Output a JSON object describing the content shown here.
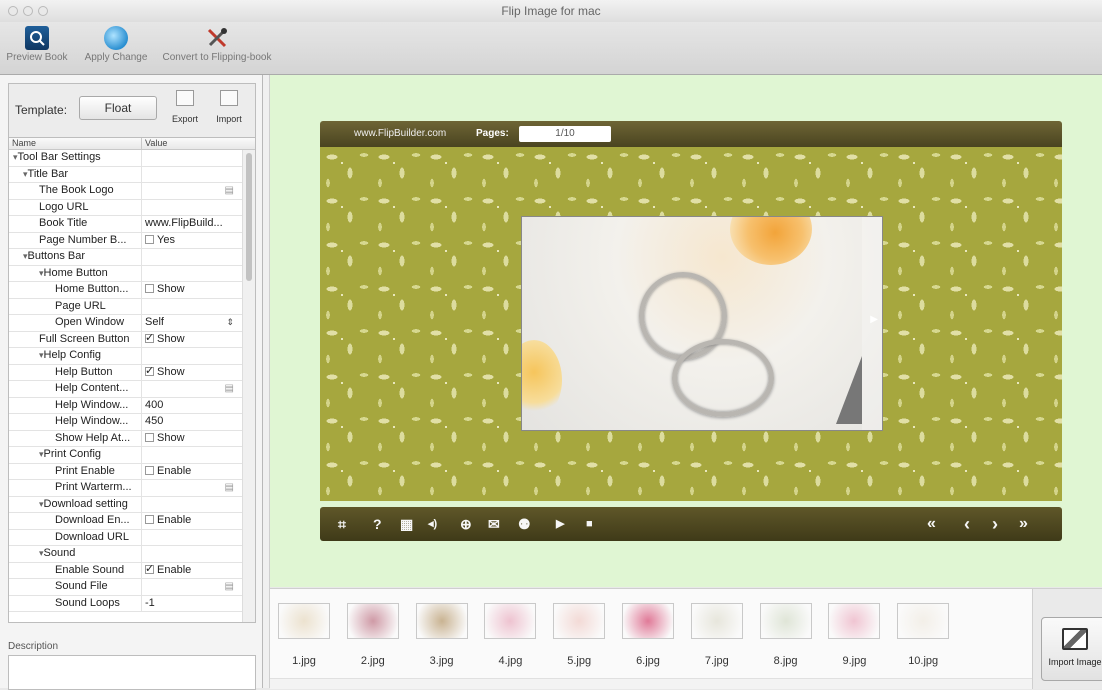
{
  "window": {
    "title": "Flip Image for mac"
  },
  "toolbar": {
    "preview_label": "Preview Book",
    "apply_label": "Apply Change",
    "convert_label": "Convert to Flipping-book"
  },
  "template": {
    "label": "Template:",
    "value": "Float",
    "export_label": "Export",
    "import_label": "Import"
  },
  "grid": {
    "col_name": "Name",
    "col_value": "Value",
    "rows": [
      {
        "name": "Tool Bar Settings",
        "type": "header"
      },
      {
        "name": "Title Bar",
        "type": "header"
      },
      {
        "name": "The Book Logo",
        "type": "file"
      },
      {
        "name": "Logo URL",
        "value": ""
      },
      {
        "name": "Book Title",
        "value": "www.FlipBuild..."
      },
      {
        "name": "Page Number B...",
        "type": "check",
        "value": "Yes",
        "checked": false
      },
      {
        "name": "Buttons Bar",
        "type": "header"
      },
      {
        "name": "Home Button",
        "type": "header"
      },
      {
        "name": "Home Button...",
        "type": "check",
        "value": "Show",
        "checked": false
      },
      {
        "name": "Page URL",
        "value": ""
      },
      {
        "name": "Open Window",
        "type": "select",
        "value": "Self"
      },
      {
        "name": "Full Screen Button",
        "type": "check",
        "value": "Show",
        "checked": true
      },
      {
        "name": "Help Config",
        "type": "header"
      },
      {
        "name": "Help Button",
        "type": "check",
        "value": "Show",
        "checked": true
      },
      {
        "name": "Help Content...",
        "type": "file"
      },
      {
        "name": "Help Window...",
        "value": "400"
      },
      {
        "name": "Help Window...",
        "value": "450"
      },
      {
        "name": "Show Help At...",
        "type": "check",
        "value": "Show",
        "checked": false
      },
      {
        "name": "Print Config",
        "type": "header"
      },
      {
        "name": "Print Enable",
        "type": "check",
        "value": "Enable",
        "checked": false
      },
      {
        "name": "Print Warterm...",
        "type": "file"
      },
      {
        "name": "Download setting",
        "type": "header"
      },
      {
        "name": "Download En...",
        "type": "check",
        "value": "Enable",
        "checked": false
      },
      {
        "name": "Download URL",
        "value": ""
      },
      {
        "name": "Sound",
        "type": "header"
      },
      {
        "name": "Enable Sound",
        "type": "check",
        "value": "Enable",
        "checked": true
      },
      {
        "name": "Sound File",
        "type": "file"
      },
      {
        "name": "Sound Loops",
        "value": "-1"
      }
    ]
  },
  "description": {
    "label": "Description"
  },
  "book": {
    "site": "www.FlipBuilder.com",
    "pages_label": "Pages:",
    "pages_value": "1/10",
    "controls": [
      "⌗",
      "?",
      "▦",
      "◂)",
      "⊕",
      "✉",
      "⚉",
      "▶",
      "■"
    ],
    "nav": [
      "«",
      "‹",
      "›",
      "»"
    ]
  },
  "thumbnails": [
    {
      "label": "1.jpg",
      "color": "#ece2cf"
    },
    {
      "label": "2.jpg",
      "color": "#cf9aa6"
    },
    {
      "label": "3.jpg",
      "color": "#c9b392"
    },
    {
      "label": "4.jpg",
      "color": "#eec3d0"
    },
    {
      "label": "5.jpg",
      "color": "#f3dad6"
    },
    {
      "label": "6.jpg",
      "color": "#e07a98"
    },
    {
      "label": "7.jpg",
      "color": "#e7e6dc"
    },
    {
      "label": "8.jpg",
      "color": "#dfe5d7"
    },
    {
      "label": "9.jpg",
      "color": "#f0c5d2"
    },
    {
      "label": "10.jpg",
      "color": "#f3efe8"
    }
  ],
  "import": {
    "label": "Import Image"
  }
}
